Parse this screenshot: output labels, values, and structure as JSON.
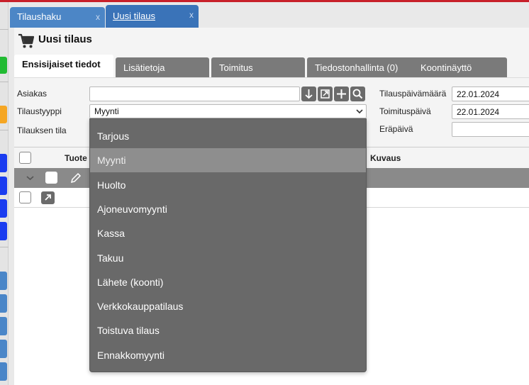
{
  "window_tabs": [
    {
      "label": "Tilaushaku",
      "close": "x"
    },
    {
      "label": "Uusi tilaus",
      "close": "x"
    }
  ],
  "page": {
    "title": "Uusi tilaus",
    "icon": "cart-icon"
  },
  "form_tabs": [
    {
      "label": "Ensisijaiset tiedot",
      "active": true
    },
    {
      "label": "Lisätietoja",
      "active": false
    },
    {
      "label": "Toimitus",
      "active": false
    },
    {
      "label": "Tiedostonhallinta (0)",
      "active": false
    },
    {
      "label": "Koontinäyttö",
      "active": false
    }
  ],
  "form": {
    "customer_label": "Asiakas",
    "customer_value": "",
    "order_type_label": "Tilaustyyppi",
    "order_type_value": "Myynti",
    "order_state_label": "Tilauksen tila",
    "order_date_label": "Tilauspäivämäärä",
    "order_date_value": "22.01.2024",
    "delivery_date_label": "Toimituspäivä",
    "delivery_date_value": "22.01.2024",
    "due_date_label": "Eräpäivä",
    "due_date_value": "",
    "icon_buttons": [
      "arrow-down-icon",
      "open-external-icon",
      "plus-icon",
      "search-icon"
    ]
  },
  "grid": {
    "columns": [
      "Tuote",
      "Kuvaus"
    ]
  },
  "dropdown": {
    "options": [
      "Tarjous",
      "Myynti",
      "Huolto",
      "Ajoneuvomyynti",
      "Kassa",
      "Takuu",
      "Lähete (koonti)",
      "Verkkokauppatilaus",
      "Toistuva tilaus",
      "Ennakkomyynti"
    ],
    "highlighted": "Myynti"
  },
  "colors": {
    "window_tab": "#4c86c6",
    "active_window_tab": "#3a73b8",
    "dropdown_bg": "#696969",
    "dropdown_highlight": "#8e8e8e",
    "accent_red": "#c8202a"
  }
}
